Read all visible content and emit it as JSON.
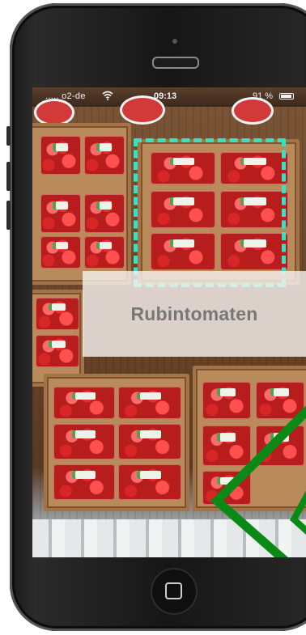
{
  "status_bar": {
    "carrier": "..... o2-de",
    "time": "09:13",
    "battery": "91 %",
    "battery_level": 0.91
  },
  "recognition": {
    "label": "Rubintomaten"
  },
  "icons": {
    "wifi": "wifi-icon",
    "battery": "battery-icon",
    "home": "home-button-icon"
  },
  "colors": {
    "focus_box": "#33e3c8",
    "arrow": "#0a8a14",
    "label_text": "#777777"
  }
}
